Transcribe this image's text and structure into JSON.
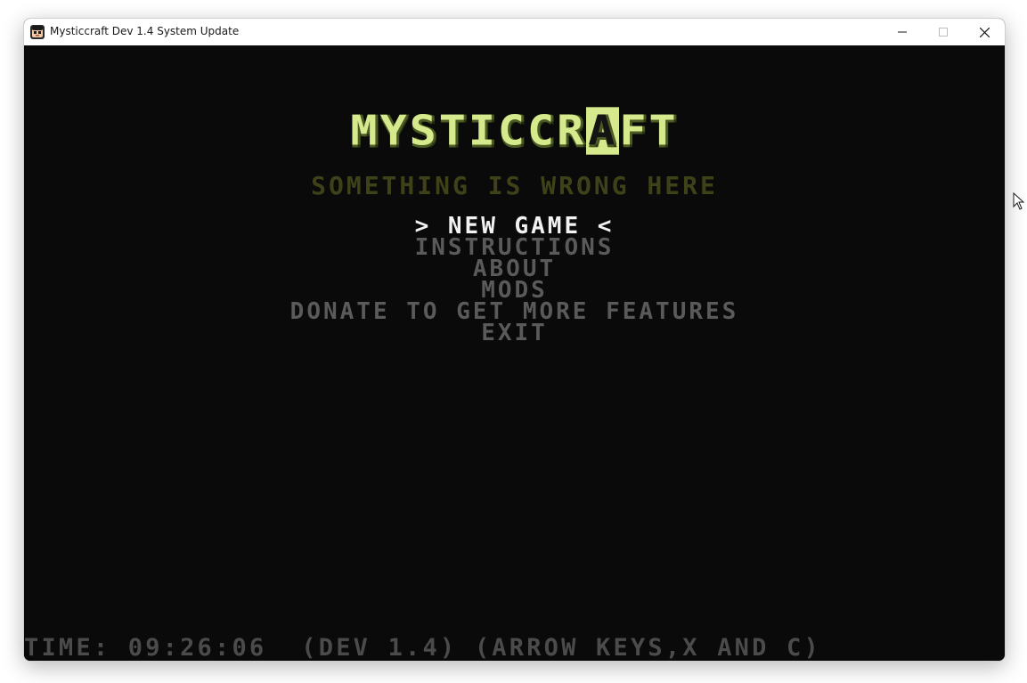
{
  "window": {
    "title": "Mysticcraft Dev 1.4 System Update",
    "icon": "app-face-icon",
    "controls": [
      "minimize-icon",
      "maximize-icon",
      "close-icon"
    ]
  },
  "game": {
    "logo": {
      "before": "MYSTICCR",
      "special": "A",
      "after": "FT"
    },
    "subtitle": "SOMETHING IS WRONG HERE",
    "menu": [
      {
        "label": "> NEW GAME <",
        "selected": true
      },
      {
        "label": "INSTRUCTIONS",
        "selected": false
      },
      {
        "label": "ABOUT",
        "selected": false
      },
      {
        "label": "MODS",
        "selected": false
      },
      {
        "label": "DONATE TO GET MORE FEATURES",
        "selected": false
      },
      {
        "label": "EXIT",
        "selected": false
      }
    ],
    "status_bar": "TIME: 09:26:06  (DEV 1.4) (ARROW KEYS,X AND C)"
  },
  "colors": {
    "logo": "#d6e98c",
    "subtitle": "#3f4118",
    "menu_selected": "#f2f2f2",
    "menu_normal": "#5a5a5a",
    "background": "#0a0a0a"
  }
}
